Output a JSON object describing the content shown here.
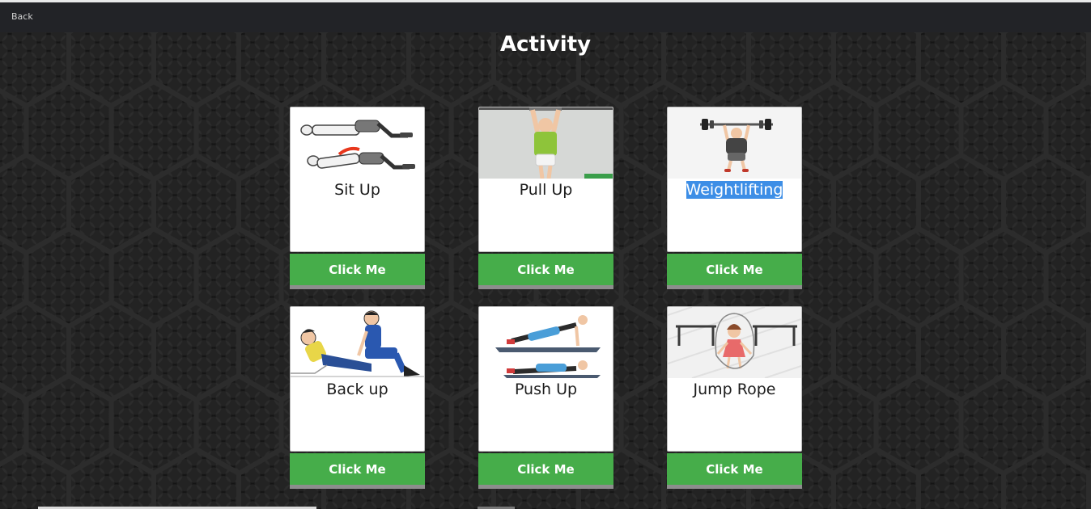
{
  "header": {
    "back_label": "Back"
  },
  "page": {
    "title": "Activity"
  },
  "activities": [
    {
      "label": "Sit Up",
      "button_label": "Click Me",
      "icon": "sit-up-illustration"
    },
    {
      "label": "Pull Up",
      "button_label": "Click Me",
      "icon": "pull-up-illustration"
    },
    {
      "label": "Weightlifting",
      "button_label": "Click Me",
      "icon": "weightlifting-illustration",
      "selected": true
    },
    {
      "label": "Back up",
      "button_label": "Click Me",
      "icon": "back-up-illustration"
    },
    {
      "label": "Push Up",
      "button_label": "Click Me",
      "icon": "push-up-illustration"
    },
    {
      "label": "Jump Rope",
      "button_label": "Click Me",
      "icon": "jump-rope-illustration"
    }
  ],
  "colors": {
    "button_bg": "#46ad4a",
    "selection": "#3d8ee6",
    "topbar": "#222327",
    "background": "#151515"
  }
}
